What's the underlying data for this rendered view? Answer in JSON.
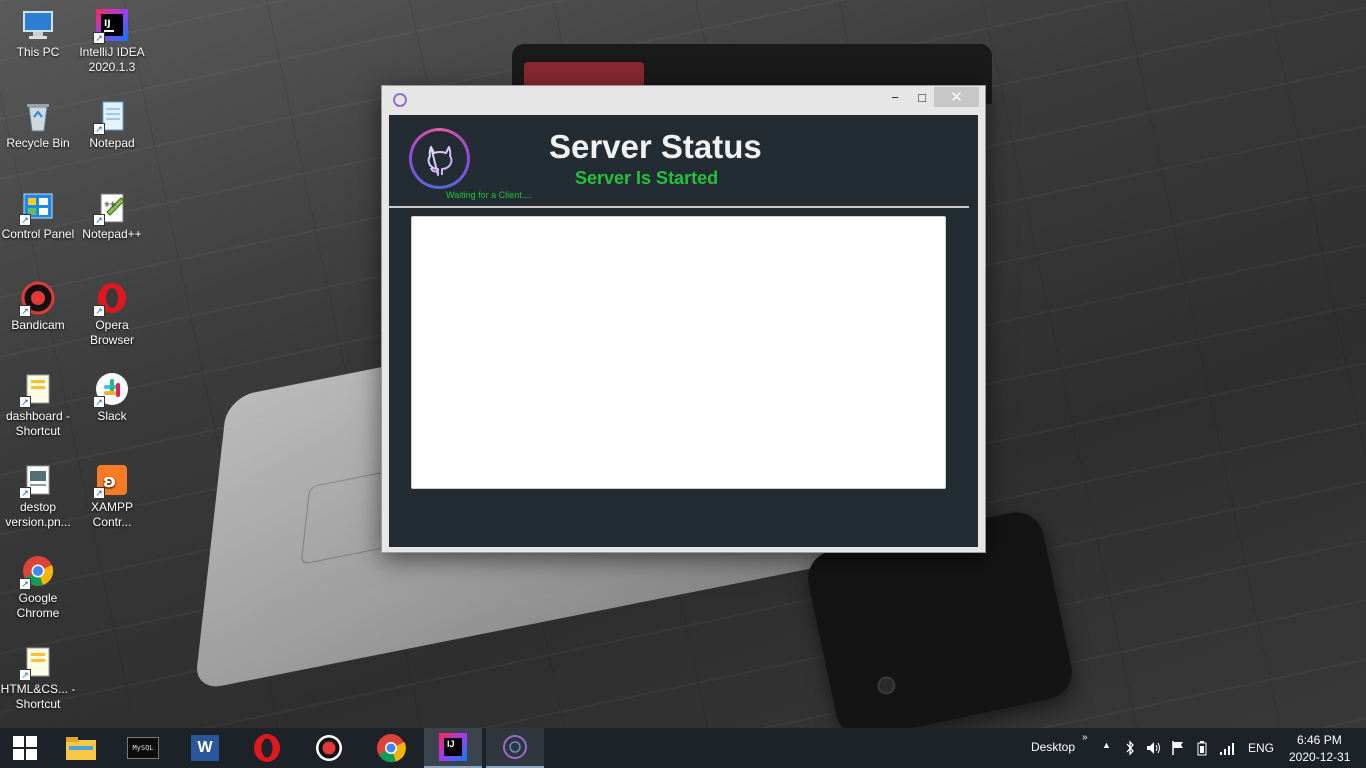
{
  "desktop": {
    "icons": [
      {
        "label": "This PC"
      },
      {
        "label": "IntelliJ IDEA 2020.1.3"
      },
      {
        "label": "Recycle Bin"
      },
      {
        "label": "Notepad"
      },
      {
        "label": "Control Panel"
      },
      {
        "label": "Notepad++"
      },
      {
        "label": "Bandicam"
      },
      {
        "label": "Opera Browser"
      },
      {
        "label": "dashboard - Shortcut"
      },
      {
        "label": "Slack"
      },
      {
        "label": "destop version.pn..."
      },
      {
        "label": "XAMPP Contr..."
      },
      {
        "label": "Google Chrome"
      },
      {
        "label": "HTML&CS... - Shortcut"
      }
    ]
  },
  "window": {
    "title": "Server Status",
    "status": "Server Is Started",
    "waiting": "Waiting for a Client....",
    "log_text": "",
    "controls": {
      "minimize": "−",
      "maximize": "□",
      "close": "✕"
    }
  },
  "taskbar": {
    "apps": [
      {
        "icon": "windows-start-icon"
      },
      {
        "icon": "file-explorer-icon"
      },
      {
        "icon": "mysql-icon",
        "text": "MySQL"
      },
      {
        "icon": "word-icon",
        "text": "W"
      },
      {
        "icon": "opera-icon"
      },
      {
        "icon": "bandicam-icon"
      },
      {
        "icon": "chrome-icon"
      },
      {
        "icon": "intellij-icon",
        "text": "IJ"
      },
      {
        "icon": "server-app-icon"
      }
    ],
    "desktop_label": "Desktop",
    "language": "ENG",
    "time": "6:46 PM",
    "date": "2020-12-31"
  },
  "colors": {
    "status_green": "#22c23a",
    "window_bg": "#242c33",
    "taskbar_bg": "#1c2228"
  }
}
